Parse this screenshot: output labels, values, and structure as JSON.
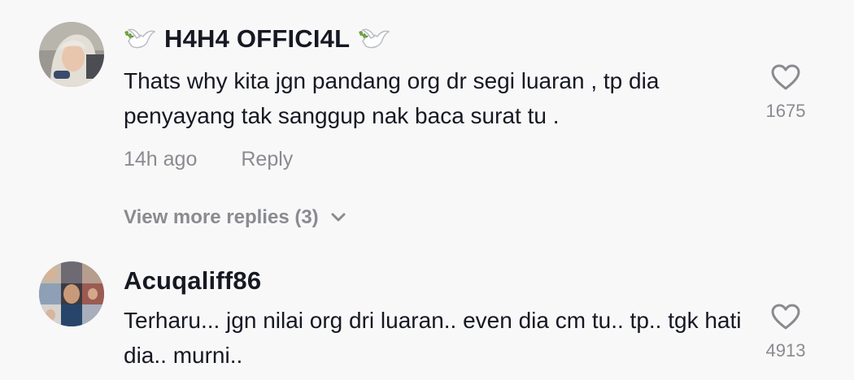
{
  "comments": [
    {
      "username": "H4H4 OFFICI4L",
      "text": "Thats why kita jgn pandang org dr segi luaran , tp dia penyayang tak sanggup nak baca surat tu .",
      "time": "14h ago",
      "reply_label": "Reply",
      "likes": "1675",
      "avatar_icon": "woman-hijab-avatar"
    },
    {
      "username": "Acuqaliff86",
      "text": "Terharu... jgn nilai org dri luaran.. even dia cm tu.. tp.. tgk hati dia.. murni..",
      "likes": "4913",
      "avatar_icon": "collage-avatar"
    }
  ],
  "view_more": {
    "label": "View more replies (3)"
  },
  "colors": {
    "background": "#f8f8f8",
    "primary_text": "#161823",
    "secondary_text": "#8a8b91"
  }
}
